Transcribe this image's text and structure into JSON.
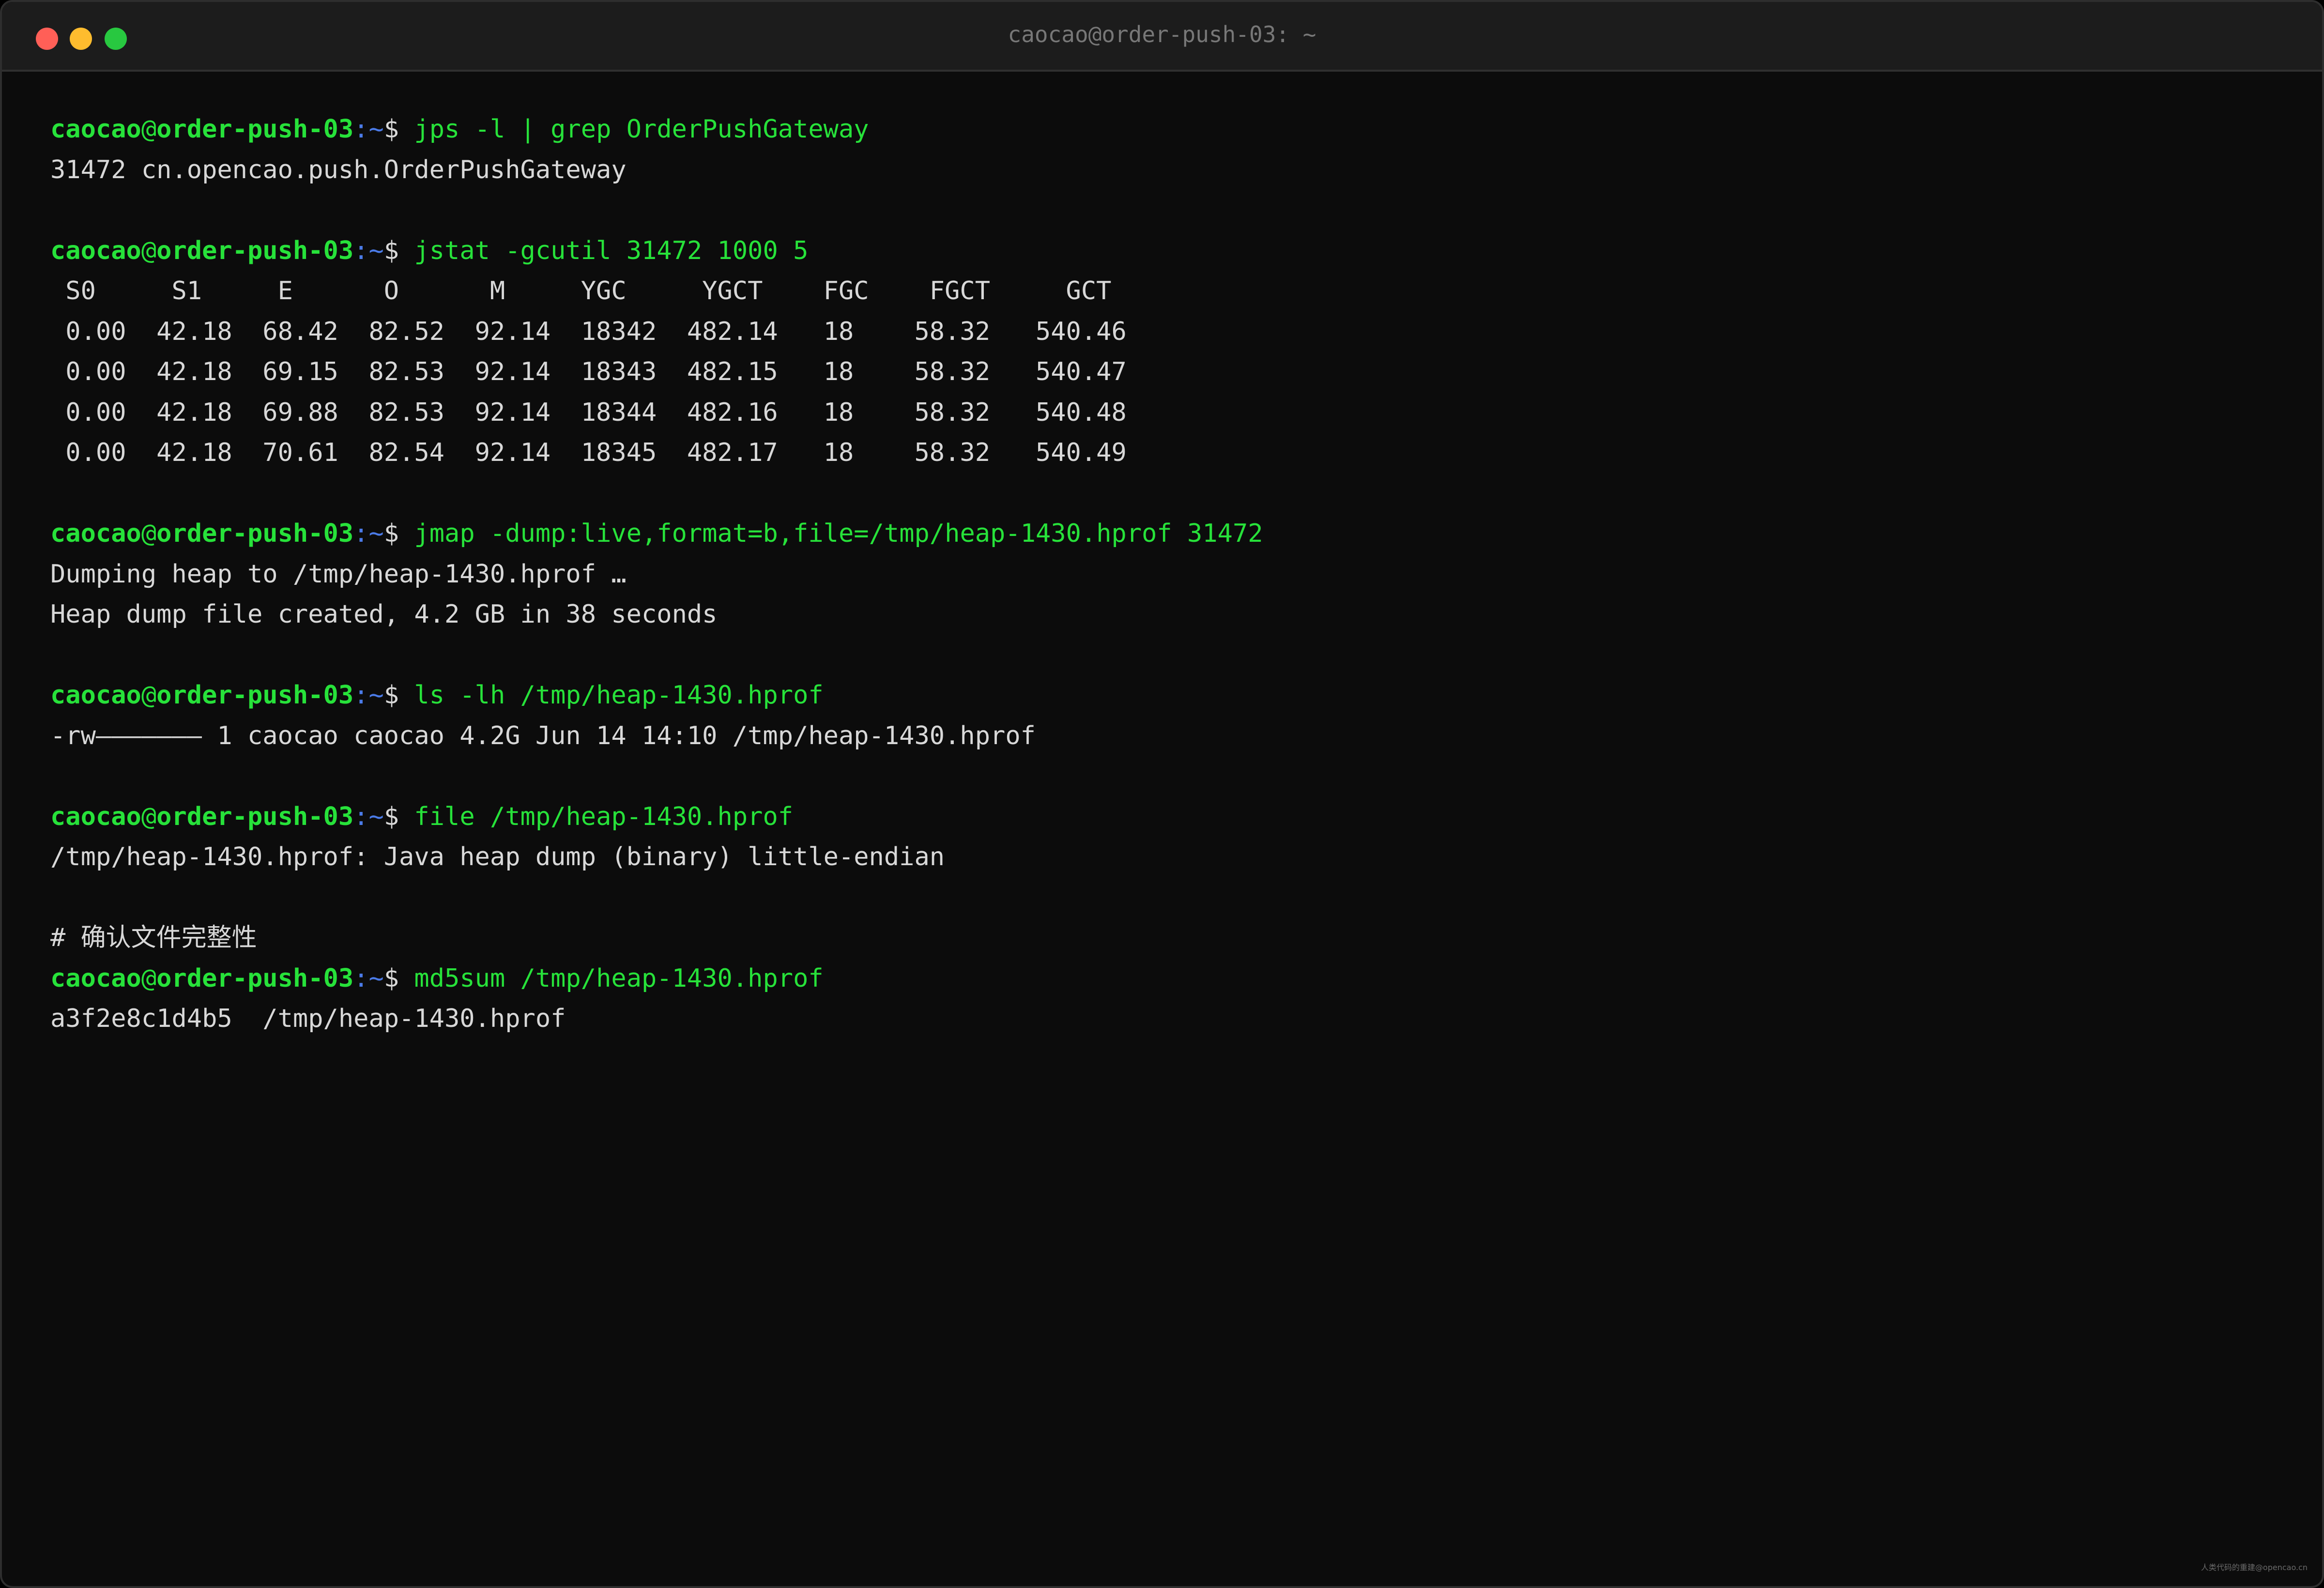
{
  "window": {
    "title": "caocao@order-push-03: ~"
  },
  "prompt": {
    "user": "caocao",
    "at": "@",
    "host": "order-push-03",
    "path": ":~",
    "symbol": "$ "
  },
  "lines": [
    {
      "type": "cmd",
      "text": "jps -l | grep OrderPushGateway"
    },
    {
      "type": "out",
      "text": "31472 cn.opencao.push.OrderPushGateway"
    },
    {
      "type": "blank"
    },
    {
      "type": "cmd",
      "text": "jstat -gcutil 31472 1000 5"
    },
    {
      "type": "out",
      "text": " S0     S1     E      O      M     YGC     YGCT    FGC    FGCT     GCT"
    },
    {
      "type": "out",
      "text": " 0.00  42.18  68.42  82.52  92.14  18342  482.14   18    58.32   540.46"
    },
    {
      "type": "out",
      "text": " 0.00  42.18  69.15  82.53  92.14  18343  482.15   18    58.32   540.47"
    },
    {
      "type": "out",
      "text": " 0.00  42.18  69.88  82.53  92.14  18344  482.16   18    58.32   540.48"
    },
    {
      "type": "out",
      "text": " 0.00  42.18  70.61  82.54  92.14  18345  482.17   18    58.32   540.49"
    },
    {
      "type": "blank"
    },
    {
      "type": "cmd",
      "text": "jmap -dump:live,format=b,file=/tmp/heap-1430.hprof 31472"
    },
    {
      "type": "out",
      "text": "Dumping heap to /tmp/heap-1430.hprof …"
    },
    {
      "type": "out",
      "text": "Heap dump file created, 4.2 GB in 38 seconds"
    },
    {
      "type": "blank"
    },
    {
      "type": "cmd",
      "text": "ls -lh /tmp/heap-1430.hprof"
    },
    {
      "type": "out",
      "text": "-rw——————— 1 caocao caocao 4.2G Jun 14 14:10 /tmp/heap-1430.hprof"
    },
    {
      "type": "blank"
    },
    {
      "type": "cmd",
      "text": "file /tmp/heap-1430.hprof"
    },
    {
      "type": "out",
      "text": "/tmp/heap-1430.hprof: Java heap dump (binary) little-endian"
    },
    {
      "type": "blank"
    },
    {
      "type": "comment",
      "text": "# 确认文件完整性"
    },
    {
      "type": "cmd",
      "text": "md5sum /tmp/heap-1430.hprof"
    },
    {
      "type": "out",
      "text": "a3f2e8c1d4b5  /tmp/heap-1430.hprof"
    }
  ],
  "watermark": "人类代码的重建@opencao.cn",
  "colors": {
    "prompt_green": "#27e23a",
    "path_blue": "#4b7be8",
    "text": "#d8d8d8",
    "background": "#0c0c0c"
  }
}
